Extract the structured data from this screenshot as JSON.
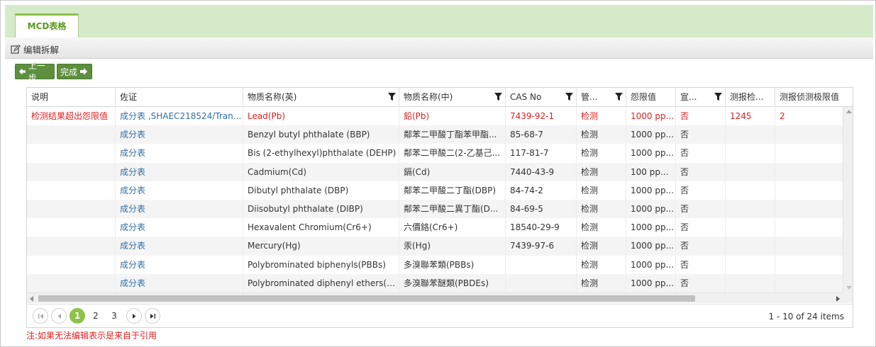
{
  "tabs": [
    {
      "label": "MCD表格"
    }
  ],
  "header": {
    "edit_label": "编辑拆解"
  },
  "toolbar": {
    "prev_label": "上一步",
    "done_label": "完成"
  },
  "grid": {
    "columns": [
      {
        "label": "说明",
        "filter": false
      },
      {
        "label": "佐证",
        "filter": false
      },
      {
        "label": "物质名称(英)",
        "filter": true
      },
      {
        "label": "物质名称(中)",
        "filter": true
      },
      {
        "label": "CAS No",
        "filter": true
      },
      {
        "label": "管...",
        "filter": true
      },
      {
        "label": "怨限值",
        "filter": false
      },
      {
        "label": "宣...",
        "filter": true
      },
      {
        "label": "测报检...",
        "filter": false
      },
      {
        "label": "测报侦测极限值",
        "filter": false
      }
    ],
    "rows": [
      {
        "highlight": true,
        "cells": [
          "检测结果超出怨限值",
          "成分表 ,SHAEC218524/Tran...",
          "Lead(Pb)",
          "鉛(Pb)",
          "7439-92-1",
          "检测",
          "1000 pp...",
          "否",
          "1245",
          "2"
        ]
      },
      {
        "highlight": false,
        "cells": [
          "",
          "成分表",
          "Benzyl butyl phthalate (BBP)",
          "鄰苯二甲酸丁酯苯甲酯...",
          "85-68-7",
          "检测",
          "1000 pp...",
          "否",
          "",
          ""
        ]
      },
      {
        "highlight": false,
        "cells": [
          "",
          "成分表",
          "Bis (2-ethylhexyl)phthalate (DEHP)",
          "鄰苯二甲酸二(2-乙基己...",
          "117-81-7",
          "检测",
          "1000 pp...",
          "否",
          "",
          ""
        ]
      },
      {
        "highlight": false,
        "cells": [
          "",
          "成分表",
          "Cadmium(Cd)",
          "鎘(Cd)",
          "7440-43-9",
          "检测",
          "100 pp...",
          "否",
          "",
          ""
        ]
      },
      {
        "highlight": false,
        "cells": [
          "",
          "成分表",
          "Dibutyl phthalate (DBP)",
          "鄰苯二甲酸二丁酯(DBP)",
          "84-74-2",
          "检测",
          "1000 pp...",
          "否",
          "",
          ""
        ]
      },
      {
        "highlight": false,
        "cells": [
          "",
          "成分表",
          "Diisobutyl phthalate (DIBP)",
          "鄰苯二甲酸二異丁酯(D...",
          "84-69-5",
          "检测",
          "1000 pp...",
          "否",
          "",
          ""
        ]
      },
      {
        "highlight": false,
        "cells": [
          "",
          "成分表",
          "Hexavalent Chromium(Cr6+)",
          "六價鉻(Cr6+)",
          "18540-29-9",
          "检测",
          "1000 pp...",
          "否",
          "",
          ""
        ]
      },
      {
        "highlight": false,
        "cells": [
          "",
          "成分表",
          "Mercury(Hg)",
          "汞(Hg)",
          "7439-97-6",
          "检测",
          "1000 pp...",
          "否",
          "",
          ""
        ]
      },
      {
        "highlight": false,
        "cells": [
          "",
          "成分表",
          "Polybrominated biphenyls(PBBs)",
          "多溴聯苯類(PBBs)",
          "",
          "检测",
          "1000 pp...",
          "否",
          "",
          ""
        ]
      },
      {
        "highlight": false,
        "cells": [
          "",
          "成分表",
          "Polybrominated diphenyl ethers(PB...",
          "多溴聯苯醚類(PBDEs)",
          "",
          "检测",
          "1000 pp...",
          "否",
          "",
          ""
        ]
      }
    ]
  },
  "pager": {
    "pages": [
      "1",
      "2",
      "3"
    ],
    "current": "1",
    "info": "1 - 10 of 24 items"
  },
  "note": "注:如果无法编辑表示是来自于引用",
  "colors": {
    "accent": "#8dc14a",
    "button": "#5e8f3f",
    "danger": "#e02020",
    "link": "#2f6fa8",
    "tabstrip": "#d6ebc9"
  }
}
